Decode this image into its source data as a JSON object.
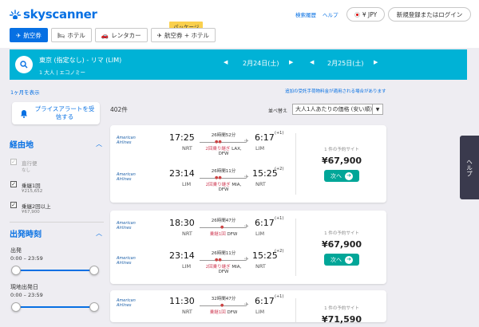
{
  "header": {
    "logo_text": "skyscanner",
    "links": [
      "検索履歴",
      "ヘルプ"
    ],
    "currency": "¥ JPY",
    "login": "新規登録またはログイン"
  },
  "tabs": [
    {
      "label": "航空券",
      "icon": "plane-icon"
    },
    {
      "label": "ホテル",
      "icon": "bed-icon"
    },
    {
      "label": "レンタカー",
      "icon": "car-icon"
    },
    {
      "label": "航空券 + ホテル",
      "icon": "plane-hotel-icon"
    }
  ],
  "package_badge": "パッケージ",
  "search": {
    "route": "東京 (指定なし) - リマ (LIM)",
    "travellers": "1 大人 | エコノミー",
    "depart_date": "2月24日(土)",
    "return_date": "2月25日(土)"
  },
  "month_view": "1ヶ月を表示",
  "fee_note": "追加の受託手荷物料金が適用される場合があります",
  "price_alert": "プライスアラートを受信する",
  "results_count": "402件",
  "sort": {
    "label": "並べ替え",
    "value": "大人1人あたりの価格 (安い順)"
  },
  "filters": {
    "stops_title": "経由地",
    "stops": [
      {
        "label": "直行便",
        "sub": "なし",
        "checked": false,
        "disabled": true
      },
      {
        "label": "乗継1回",
        "sub": "¥215,652",
        "checked": true,
        "disabled": false
      },
      {
        "label": "乗継2回以上",
        "sub": "¥67,900",
        "checked": true,
        "disabled": false
      }
    ],
    "time_title": "出発時刻",
    "depart_label": "出発",
    "depart_range": "0:00 – 23:59",
    "return_label": "現地出発日",
    "return_range": "0:00 – 23:59"
  },
  "help_tab": "ヘルプ",
  "results": [
    {
      "legs": [
        {
          "airline": "American Airlines",
          "dep": "17:25",
          "from": "NRT",
          "arr": "6:17",
          "plus": "(+1)",
          "to": "LIM",
          "duration": "26時間52分",
          "stops": "2回乗り継ぎ",
          "via": "LAX,",
          "via2": "DFW"
        },
        {
          "airline": "American Airlines",
          "dep": "23:14",
          "from": "LIM",
          "arr": "15:25",
          "plus": "(+2)",
          "to": "NRT",
          "duration": "26時間11分",
          "stops": "2回乗り継ぎ",
          "via": "MIA,",
          "via2": "DFW"
        }
      ],
      "deal_label": "1 件の予約サイト",
      "price": "¥67,900",
      "cta": "次へ"
    },
    {
      "legs": [
        {
          "airline": "American Airlines",
          "dep": "18:30",
          "from": "NRT",
          "arr": "6:17",
          "plus": "(+1)",
          "to": "LIM",
          "duration": "26時間47分",
          "stops": "乗継1回",
          "via": "DFW",
          "via2": ""
        },
        {
          "airline": "American Airlines",
          "dep": "23:14",
          "from": "LIM",
          "arr": "15:25",
          "plus": "(+2)",
          "to": "NRT",
          "duration": "26時間11分",
          "stops": "2回乗り継ぎ",
          "via": "MIA,",
          "via2": "DFW"
        }
      ],
      "deal_label": "1 件の予約サイト",
      "price": "¥67,900",
      "cta": "次へ"
    },
    {
      "legs": [
        {
          "airline": "American Airlines",
          "dep": "11:30",
          "from": "NRT",
          "arr": "6:17",
          "plus": "(+1)",
          "to": "LIM",
          "duration": "32時間47分",
          "stops": "乗継1回",
          "via": "DFW",
          "via2": ""
        }
      ],
      "deal_label": "1 件の予約サイト",
      "price": "¥71,590",
      "cta": "次へ"
    }
  ]
}
